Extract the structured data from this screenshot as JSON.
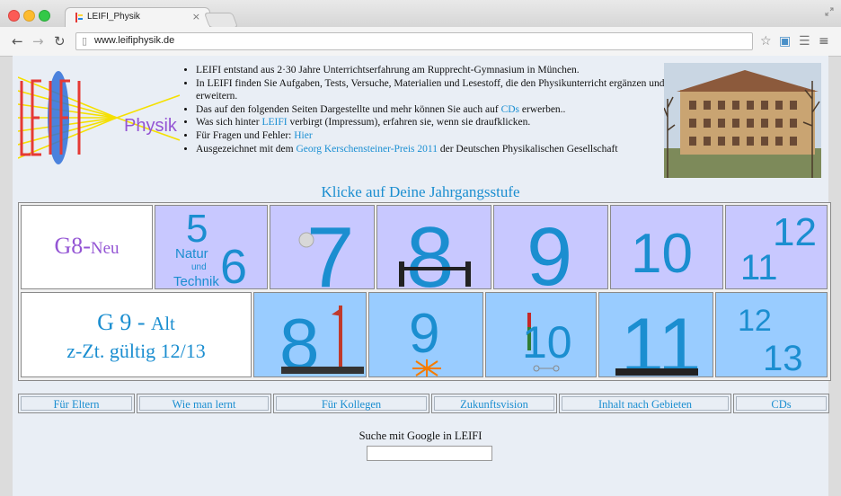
{
  "browser": {
    "tab_title": "LEIFI_Physik",
    "tab_close": "×",
    "url": "www.leifiphysik.de",
    "icons": [
      "back-icon",
      "forward-icon",
      "reload-icon",
      "star-icon",
      "extension-icon",
      "reader-icon",
      "menu-icon"
    ]
  },
  "logo": {
    "letters": "LEIFI",
    "word": "Physik"
  },
  "intro": {
    "items": [
      {
        "text": "LEIFI entstand aus 2·30 Jahre Unterrichtserfahrung am Rupprecht-Gymnasium in München."
      },
      {
        "text": "In LEIFI finden Sie Aufgaben, Tests, Versuche, Materialien und Lesestoff, die den Physikunterricht ergänzen und erweitern."
      },
      {
        "pre": "Das auf den folgenden Seiten Dargestellte und mehr können Sie auch auf ",
        "link": "CDs",
        "post": " erwerben.."
      },
      {
        "pre": "Was sich hinter ",
        "link": "LEIFI",
        "post": " verbirgt (Impressum), erfahren sie, wenn sie draufklicken."
      },
      {
        "pre": "Für Fragen und Fehler: ",
        "link": "Hier",
        "post": ""
      },
      {
        "pre": "Ausgezeichnet mit dem ",
        "link": "Georg Kerschensteiner-Preis 2011",
        "post": " der Deutschen Physikalischen Gesellschaft"
      }
    ]
  },
  "heading": "Klicke auf Deine Jahrgangsstufe",
  "g8": {
    "label": "G8-",
    "label2": "Neu",
    "grade56": {
      "five": "5",
      "six": "6",
      "natur": "Natur",
      "und": "und",
      "technik": "Technik"
    },
    "grades": [
      "7",
      "8",
      "9",
      "10"
    ],
    "g1112": {
      "eleven": "11",
      "twelve": "12"
    }
  },
  "g9": {
    "label_line1": "G 9 - ",
    "label_alt": "Alt",
    "label_line2": "z-Zt. gültig 12/13",
    "grades": [
      "8",
      "9",
      "10",
      "11"
    ],
    "g1213": {
      "twelve": "12",
      "thirteen": "13"
    }
  },
  "nav": [
    "Für Eltern",
    "Wie man lernt",
    "Für Kollegen",
    "Zukunftsvision",
    "Inhalt nach Gebieten",
    "CDs"
  ],
  "search": {
    "label": "Suche mit Google in LEIFI",
    "value": ""
  },
  "colors": {
    "accent": "#1b8ed0",
    "g8_bg": "#c8c8ff",
    "g9_bg": "#99ccff",
    "purple": "#9455d4"
  }
}
